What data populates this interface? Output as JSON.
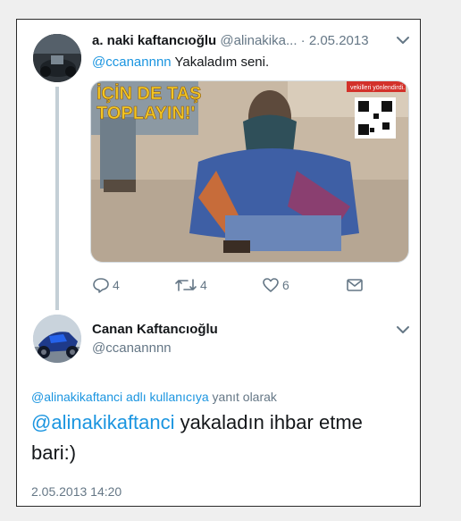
{
  "tweet1": {
    "name": "a. naki kaftancıoğlu",
    "handle": "@alinakika...",
    "date": "· 2.05.2013",
    "mention": "@ccanannnn",
    "text": " Yakaladım seni.",
    "image": {
      "headline_line1": "İÇİN DE TAŞ",
      "headline_line2": "TOPLAYIN!'",
      "small_caption": "vekilleri yönlendirdi."
    },
    "counts": {
      "replies": "4",
      "retweets": "4",
      "likes": "6"
    }
  },
  "tweet2": {
    "name": "Canan Kaftancıoğlu",
    "handle": "@ccanannnn",
    "reply_to_link": "@alinakikaftanci adlı kullanıcıya",
    "reply_to_suffix": " yanıt olarak",
    "mention": "@alinakikaftanci",
    "text": " yakaladın ihbar etme bari:)",
    "timestamp": "2.05.2013 14:20"
  },
  "colors": {
    "link": "#1b95e0",
    "muted": "#657786",
    "text": "#14171a"
  },
  "icons": [
    "chevron-down-icon",
    "reply-icon",
    "retweet-icon",
    "like-icon",
    "direct-message-icon"
  ]
}
